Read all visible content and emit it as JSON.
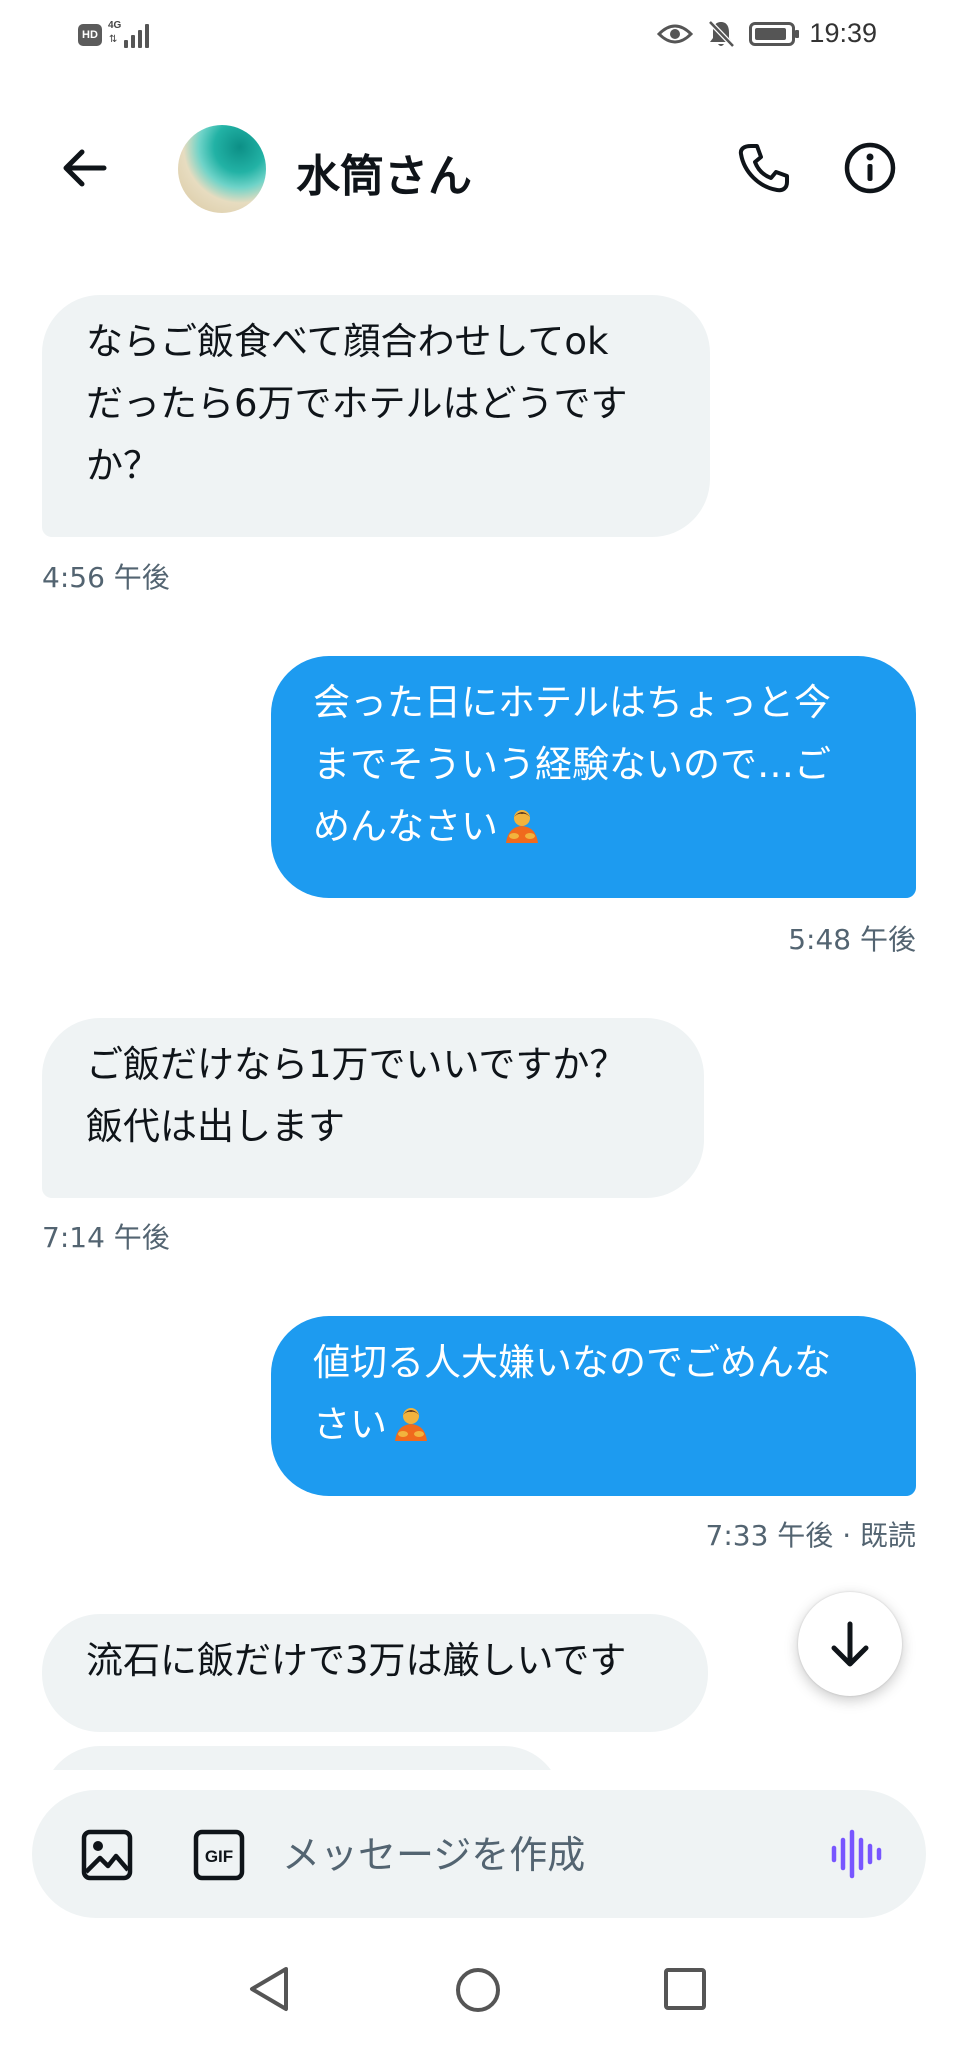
{
  "status_bar": {
    "hd": "HD",
    "network": "4G",
    "time": "19:39",
    "icons": [
      "hd-icon",
      "signal-icon",
      "eye-icon",
      "bell-off-icon",
      "battery-icon"
    ]
  },
  "header": {
    "contact_name": "水筒さん",
    "icons": [
      "back-arrow-icon",
      "phone-icon",
      "info-icon"
    ]
  },
  "messages": [
    {
      "direction": "incoming",
      "lines": [
        "ならご飯食べて顔合わせしてok",
        "だったら6万でホテルはどうです",
        "か？"
      ],
      "timestamp": "4:56 午後"
    },
    {
      "direction": "outgoing",
      "lines": [
        "会った日にホテルはちょっと今",
        "までそういう経験ないので…ご",
        "めんなさい"
      ],
      "emoji": "person-bowing-emoji",
      "timestamp": "5:48 午後"
    },
    {
      "direction": "incoming",
      "lines": [
        "ご飯だけなら1万でいいですか？",
        "飯代は出します"
      ],
      "timestamp": "7:14 午後"
    },
    {
      "direction": "outgoing",
      "lines": [
        "値切る人大嫌いなのでごめんな",
        "さい"
      ],
      "emoji": "person-bowing-emoji",
      "timestamp": "7:33 午後 · 既読"
    },
    {
      "direction": "incoming",
      "lines": [
        "流石に飯だけで3万は厳しいです"
      ]
    }
  ],
  "composer": {
    "placeholder": "メッセージを作成",
    "gif_label": "GIF",
    "icons": [
      "image-icon",
      "gif-icon",
      "voice-icon"
    ]
  },
  "colors": {
    "outgoing_bubble": "#1d9bf0",
    "incoming_bubble": "#eff3f4",
    "timestamp": "#536471",
    "voice_accent": "#7856ff"
  }
}
